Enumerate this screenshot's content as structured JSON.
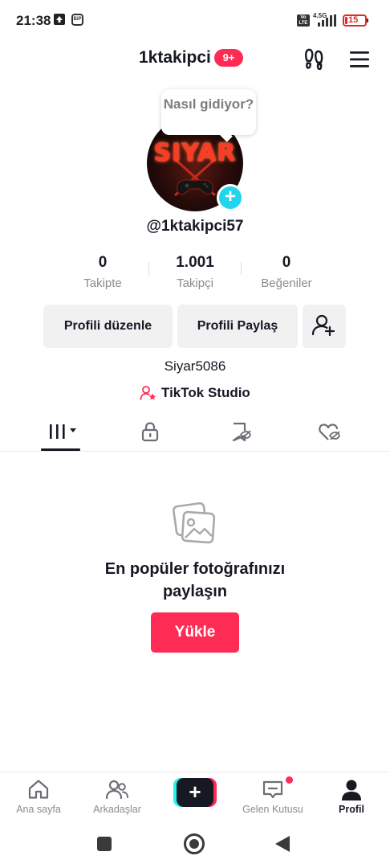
{
  "status_bar": {
    "time": "21:38",
    "app_badge": "BiP",
    "volte": "Vo LTE",
    "network": "4.5G",
    "battery": "15"
  },
  "header": {
    "title": "1ktakipci",
    "notification_count": "9+"
  },
  "profile": {
    "avatar_text": "SIYAR",
    "bubble_text": "Nasıl gidiyor?",
    "handle": "@1ktakipci57",
    "display_name": "Siyar5086"
  },
  "stats": [
    {
      "value": "0",
      "label": "Takipte"
    },
    {
      "value": "1.001",
      "label": "Takipçi"
    },
    {
      "value": "0",
      "label": "Beğeniler"
    }
  ],
  "actions": {
    "edit_profile": "Profili düzenle",
    "share_profile": "Profili Paylaş"
  },
  "studio": {
    "label": "TikTok Studio"
  },
  "tabs": [
    {
      "icon": "grid-icon",
      "active": true
    },
    {
      "icon": "lock-icon",
      "active": false
    },
    {
      "icon": "bookmark-icon",
      "active": false
    },
    {
      "icon": "liked-icon",
      "active": false
    }
  ],
  "empty_state": {
    "title": "En popüler fotoğrafınızı paylaşın",
    "button": "Yükle"
  },
  "bottom_nav": [
    {
      "label": "Ana sayfa",
      "icon": "home-icon"
    },
    {
      "label": "Arkadaşlar",
      "icon": "friends-icon"
    },
    {
      "label": "",
      "icon": "plus-icon"
    },
    {
      "label": "Gelen Kutusu",
      "icon": "inbox-icon"
    },
    {
      "label": "Profil",
      "icon": "profile-icon"
    }
  ],
  "colors": {
    "accent": "#fe2c55",
    "cyan": "#25f4ee",
    "text": "#161823",
    "muted": "#8a8b91",
    "button_bg": "#f1f1f2"
  }
}
